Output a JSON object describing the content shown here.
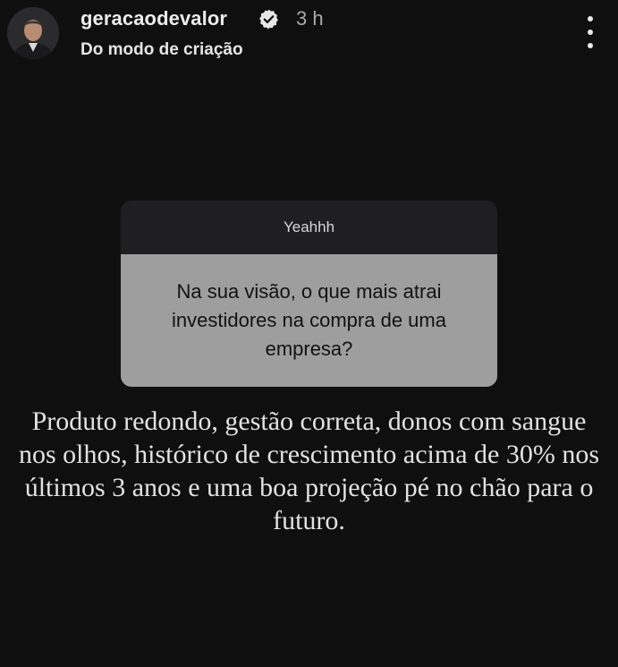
{
  "header": {
    "username": "geracaodevalor",
    "time": "3 h",
    "subtitle": "Do modo de criação",
    "verified_icon": "verified-badge-icon",
    "more_icon": "more-vertical-icon"
  },
  "question_sticker": {
    "title": "Yeahhh",
    "question": "Na sua visão, o que mais atrai investidores na compra de uma empresa?"
  },
  "answer": {
    "text": "Produto redondo, gestão correta, donos com sangue nos olhos, histórico de crescimento acima de 30% nos últimos 3 anos e uma boa projeção pé no chão para o futuro."
  },
  "colors": {
    "background": "#0f0f10",
    "sticker_header": "#1f1f21",
    "sticker_body": "#9e9e9e"
  }
}
